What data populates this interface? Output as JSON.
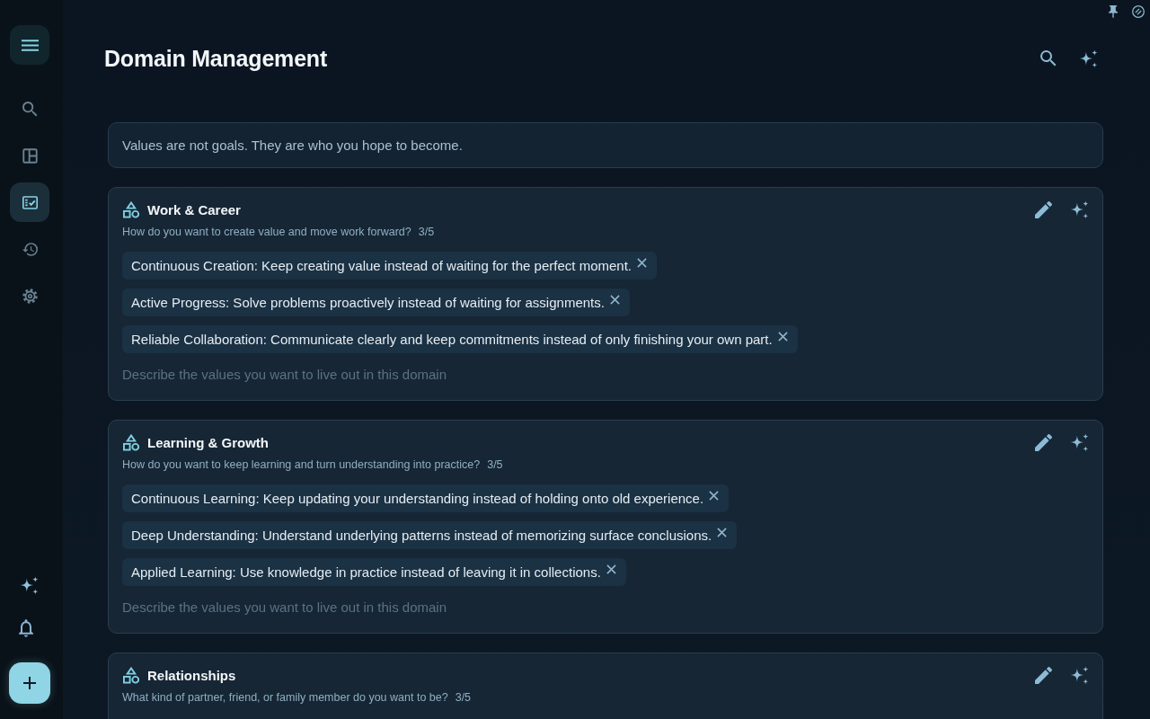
{
  "sidebar": {
    "nav": [
      {
        "kind": "search",
        "selected": false
      },
      {
        "kind": "layout",
        "selected": false
      },
      {
        "kind": "tasks",
        "selected": true
      },
      {
        "kind": "history",
        "selected": false
      },
      {
        "kind": "settings",
        "selected": false
      }
    ]
  },
  "header": {
    "title": "Domain Management"
  },
  "quote": "Values are not goals. They are who you hope to become.",
  "domains": [
    {
      "title": "Work & Career",
      "question": "How do you want to create value and move work forward?",
      "count": "3/5",
      "values": [
        "Continuous Creation: Keep creating value instead of waiting for the perfect moment.",
        "Active Progress: Solve problems proactively instead of waiting for assignments.",
        "Reliable Collaboration: Communicate clearly and keep commitments instead of only finishing your own part."
      ],
      "placeholder": "Describe the values you want to live out in this domain"
    },
    {
      "title": "Learning & Growth",
      "question": "How do you want to keep learning and turn understanding into practice?",
      "count": "3/5",
      "values": [
        "Continuous Learning: Keep updating your understanding instead of holding onto old experience.",
        "Deep Understanding: Understand underlying patterns instead of memorizing surface conclusions.",
        "Applied Learning: Use knowledge in practice instead of leaving it in collections."
      ],
      "placeholder": "Describe the values you want to live out in this domain"
    },
    {
      "title": "Relationships",
      "question": "What kind of partner, friend, or family member do you want to be?",
      "count": "3/5"
    }
  ]
}
